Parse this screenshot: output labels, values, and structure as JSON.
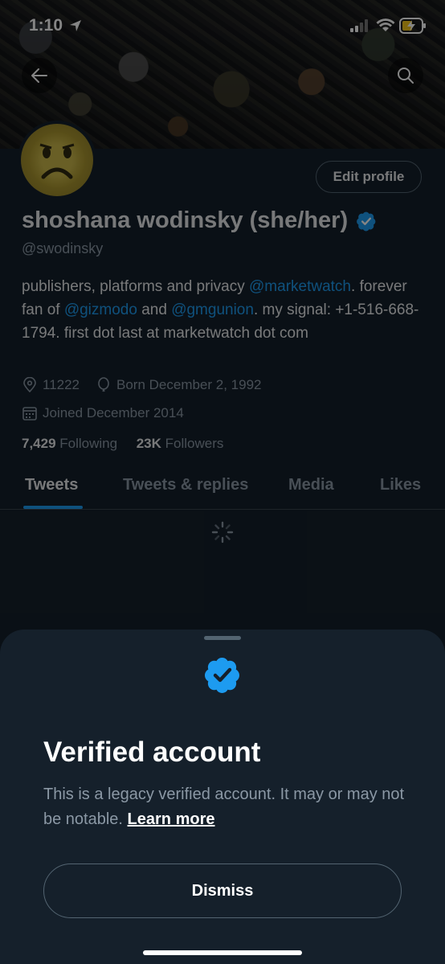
{
  "status_bar": {
    "time": "1:10"
  },
  "profile": {
    "name": "shoshana wodinsky (she/her)",
    "handle": "@swodinsky",
    "edit_label": "Edit profile",
    "bio": {
      "p1": "publishers, platforms and privacy ",
      "m1": "@marketwatch",
      "p2": ". forever fan of ",
      "m2": "@gizmodo",
      "p3": " and ",
      "m3": "@gmgunion",
      "p4": ". my signal: +1-516-668-1794. first dot last at marketwatch dot com"
    },
    "location": "11222",
    "born": "Born December 2, 1992",
    "joined": "Joined December 2014",
    "following_count": "7,429",
    "following_label": "Following",
    "followers_count": "23K",
    "followers_label": "Followers"
  },
  "tabs": [
    {
      "label": "Tweets",
      "active": true
    },
    {
      "label": "Tweets & replies"
    },
    {
      "label": "Media"
    },
    {
      "label": "Likes"
    }
  ],
  "sheet": {
    "title": "Verified account",
    "text": "This is a legacy verified account. It may or may not be notable.",
    "learn_more": "Learn more",
    "dismiss": "Dismiss"
  },
  "colors": {
    "background": "#15202b",
    "accent": "#1d9bf0",
    "secondary_text": "#8b98a5",
    "border": "#536471"
  },
  "icons": [
    "location-arrow-icon",
    "signal-icon",
    "wifi-icon",
    "battery-charging-icon",
    "back-arrow-icon",
    "search-icon",
    "verified-badge-icon",
    "location-pin-icon",
    "balloon-icon",
    "calendar-icon",
    "loading-spinner-icon"
  ]
}
